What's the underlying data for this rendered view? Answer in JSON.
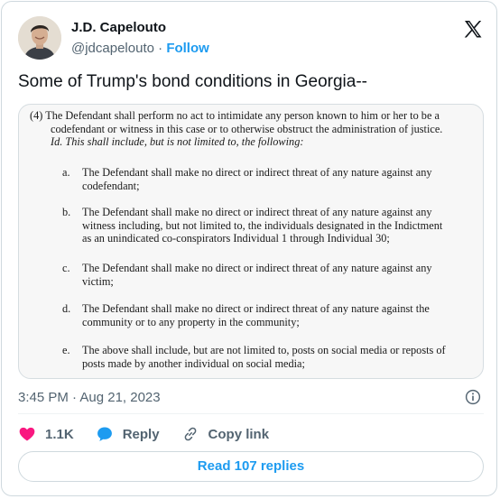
{
  "author": {
    "name": "J.D. Capelouto",
    "handle": "@jdcapelouto",
    "separator": "·",
    "follow_label": "Follow"
  },
  "tweet": {
    "text": "Some of Trump's bond conditions in Georgia--"
  },
  "document": {
    "intro_lines": [
      "(4) The Defendant shall perform no act to intimidate any person known to him or her to be a",
      "codefendant or witness in this case or to otherwise obstruct the administration of justice.",
      "Id. This shall include, but is not limited to, the following:"
    ],
    "items": [
      {
        "letter": "a.",
        "lines": [
          "The Defendant shall make no direct or indirect threat of any nature against any",
          "codefendant;"
        ]
      },
      {
        "letter": "b.",
        "lines": [
          "The Defendant shall make no direct or indirect threat of any nature against any",
          "witness including, but not limited to, the individuals designated in the Indictment",
          "as an unindicated co-conspirators Individual 1 through Individual 30;"
        ]
      },
      {
        "letter": "c.",
        "lines": [
          "The Defendant shall make no direct or indirect threat of any nature against any",
          "victim;"
        ]
      },
      {
        "letter": "d.",
        "lines": [
          "The Defendant shall make no direct or indirect threat of any nature against the",
          "community or to any property in the community;"
        ]
      },
      {
        "letter": "e.",
        "lines": [
          "The above shall include, but are not limited to, posts on social media or reposts of",
          "posts made by another individual on social media;"
        ]
      }
    ]
  },
  "meta": {
    "timestamp": "3:45 PM · Aug 21, 2023"
  },
  "actions": {
    "like_count": "1.1K",
    "reply_label": "Reply",
    "copy_label": "Copy link"
  },
  "read_replies_label": "Read 107 replies",
  "colors": {
    "accent": "#1d9bf0",
    "like": "#f91880",
    "text": "#0f1419",
    "muted": "#536471",
    "border": "#cfd9de"
  },
  "icons": [
    "x-logo-icon",
    "info-icon",
    "heart-icon",
    "reply-bubble-icon",
    "link-icon"
  ]
}
